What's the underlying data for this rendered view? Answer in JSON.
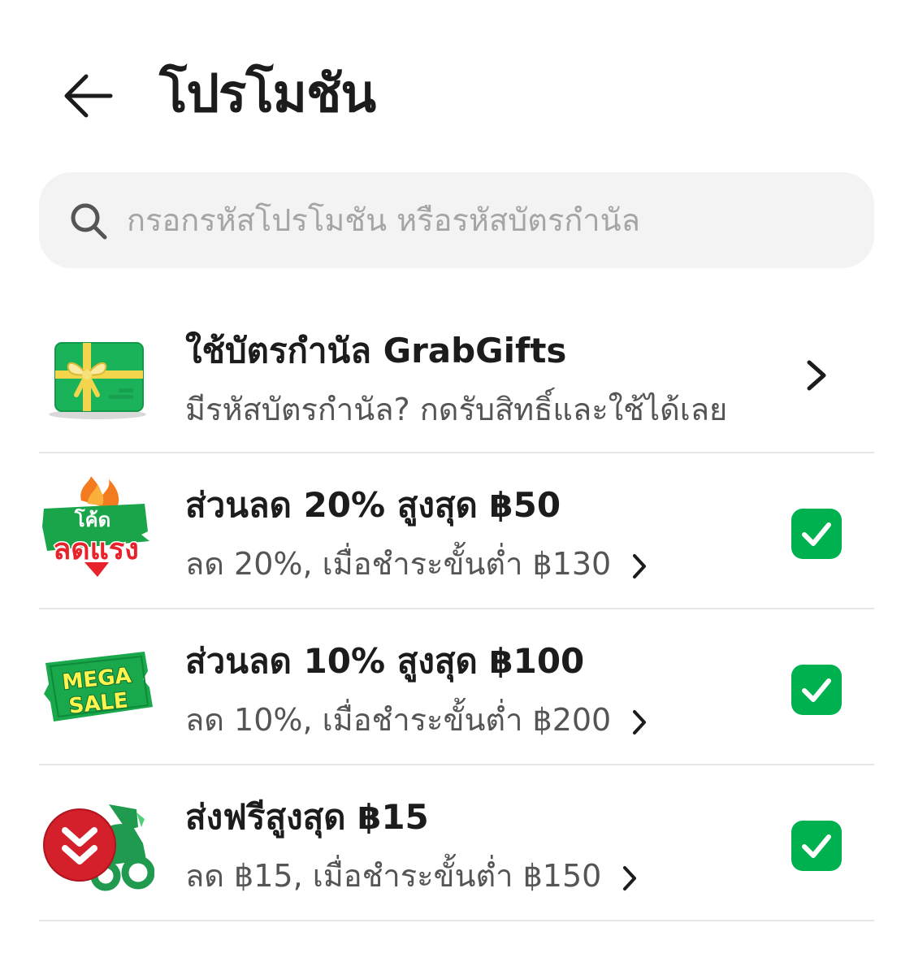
{
  "header": {
    "title": "โปรโมชัน"
  },
  "search": {
    "placeholder": "กรอกรหัสโปรโมชัน หรือรหัสบัตรกำนัล"
  },
  "gift_card": {
    "title": "ใช้บัตรกำนัล GrabGifts",
    "subtitle": "มีรหัสบัตรกำนัล? กดรับสิทธิ์และใช้ได้เลย",
    "icon": "gift-card-icon"
  },
  "promos": [
    {
      "title": "ส่วนลด 20% สูงสุด ฿50",
      "subtitle": "ลด 20%, เมื่อชำระขั้นต่ำ ฿130",
      "badge": {
        "line1": "โค้ด",
        "line2": "ลดแรง"
      },
      "selected": true
    },
    {
      "title": "ส่วนลด 10% สูงสุด ฿100",
      "subtitle": "ลด 10%, เมื่อชำระขั้นต่ำ ฿200",
      "badge": {
        "line1": "MEGA",
        "line2": "SALE"
      },
      "selected": true
    },
    {
      "title": "ส่งฟรีสูงสุด ฿15",
      "subtitle": "ลด ฿15, เมื่อชำระขั้นต่ำ ฿150",
      "icon": "delivery-scooter-icon",
      "selected": true
    }
  ],
  "colors": {
    "accent": "#00b14f",
    "divider": "#e6e6e6",
    "search_bg": "#f3f3f3"
  }
}
